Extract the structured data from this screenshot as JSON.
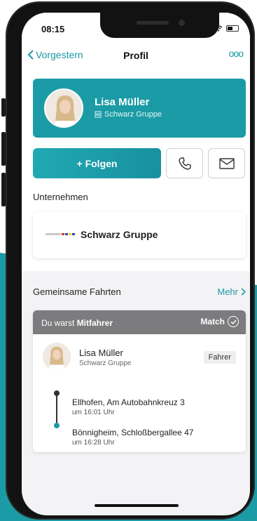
{
  "status_bar": {
    "time": "08:15"
  },
  "nav": {
    "back_label": "Vorgestern",
    "title": "Profil",
    "more_label": "ooo"
  },
  "profile": {
    "name": "Lisa Müller",
    "company": "Schwarz Gruppe"
  },
  "actions": {
    "follow_label": "+ Folgen",
    "phone_icon": "phone-icon",
    "mail_icon": "mail-icon"
  },
  "company_section": {
    "label": "Unternehmen",
    "company_name": "Schwarz Gruppe"
  },
  "rides_section": {
    "label": "Gemeinsame Fahrten",
    "more_label": "Mehr",
    "ride": {
      "header_prefix": "Du warst ",
      "header_role": "Mitfahrer",
      "match_label": "Match",
      "driver_name": "Lisa Müller",
      "driver_company": "Schwarz Gruppe",
      "role_badge": "Fahrer",
      "stops": [
        {
          "name": "Ellhofen, Am Autobahnkreuz 3",
          "time": "um 16:01 Uhr"
        },
        {
          "name": "Bönnigheim, Schloßbergallee 47",
          "time": "um 16:28 Uhr"
        }
      ]
    }
  },
  "colors": {
    "accent": "#1b9ba5",
    "header_gray": "#7c7c7e",
    "background": "#f3f3f5"
  }
}
